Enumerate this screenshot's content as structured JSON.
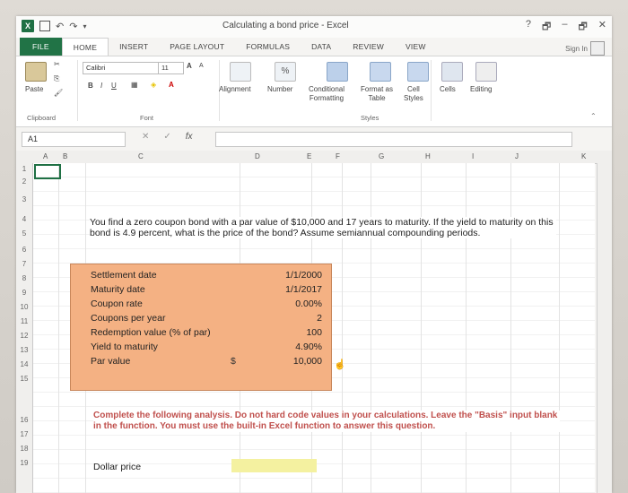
{
  "window": {
    "title": "Calculating a bond price - Excel",
    "help": "?",
    "minimize": "–",
    "restore": "🗗",
    "close": "✕"
  },
  "tabs": [
    "FILE",
    "HOME",
    "INSERT",
    "PAGE LAYOUT",
    "FORMULAS",
    "DATA",
    "REVIEW",
    "VIEW"
  ],
  "signin": "Sign In",
  "ribbon": {
    "paste": "Paste",
    "clipboard": "Clipboard",
    "font_name": "Calibri",
    "font_size": "11",
    "grow": "A",
    "shrink": "A",
    "bold": "B",
    "italic": "I",
    "underline": "U",
    "font_group": "Font",
    "alignment": "Alignment",
    "number": "Number",
    "conditional": "Conditional",
    "formatting": "Formatting",
    "format_as": "Format as",
    "table": "Table",
    "cell": "Cell",
    "styles_btn": "Styles",
    "cells": "Cells",
    "editing": "Editing",
    "styles_group": "Styles",
    "percent": "%"
  },
  "formula_bar": {
    "name_box": "A1",
    "cancel": "✕",
    "enter": "✓",
    "fx": "fx",
    "formula": ""
  },
  "columns": [
    "A",
    "B",
    "C",
    "D",
    "E",
    "F",
    "G",
    "H",
    "I",
    "J",
    "K"
  ],
  "rows": [
    "1",
    "2",
    "3",
    "4",
    "5",
    "6",
    "7",
    "8",
    "9",
    "10",
    "11",
    "12",
    "13",
    "14",
    "15",
    "16",
    "17",
    "18",
    "19"
  ],
  "sheet": {
    "question": "You find a zero coupon bond with a par value of $10,000 and 17 years to maturity. If the yield to maturity on this bond is 4.9 percent, what is the price of the bond? Assume semiannual compounding periods.",
    "inputs": [
      {
        "label": "Settlement date",
        "value": "1/1/2000"
      },
      {
        "label": "Maturity date",
        "value": "1/1/2017"
      },
      {
        "label": "Coupon rate",
        "value": "0.00%"
      },
      {
        "label": "Coupons per year",
        "value": "2"
      },
      {
        "label": "Redemption value (% of par)",
        "value": "100"
      },
      {
        "label": "Yield to maturity",
        "value": "4.90%"
      },
      {
        "label": "Par value",
        "value": "10,000"
      }
    ],
    "currency_symbol": "$",
    "instructions": "Complete the following analysis. Do not hard code values in your calculations. Leave the \"Basis\" input blank in the function. You must use the built-in Excel function to answer this question.",
    "dollar_price_label": "Dollar price"
  },
  "colors": {
    "excel_green": "#217346",
    "input_fill": "#f4b183",
    "answer_fill": "#f4f1a0",
    "instruction_red": "#c0504d"
  }
}
